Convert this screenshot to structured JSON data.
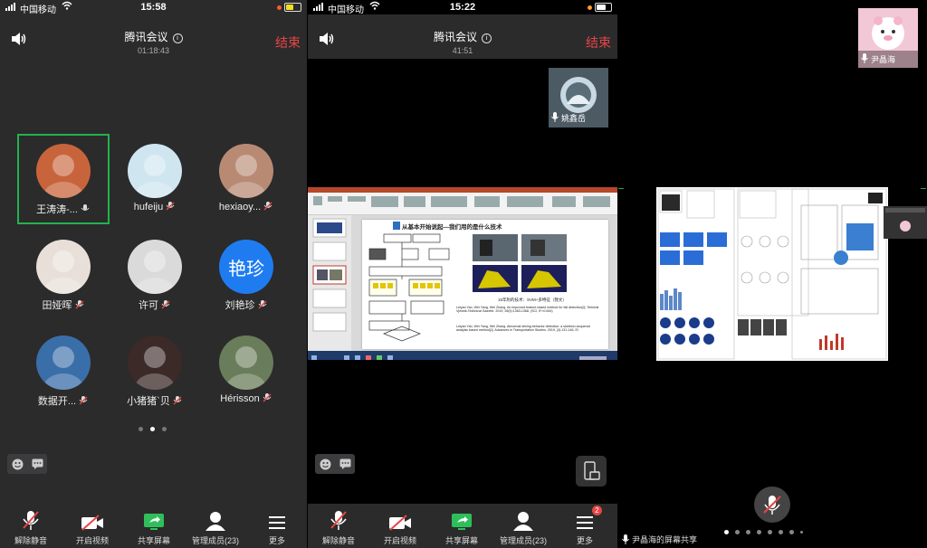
{
  "panel1": {
    "status": {
      "carrier": "中国移动",
      "time": "15:58"
    },
    "header": {
      "title": "腾讯会议",
      "duration": "01:18:43",
      "end_label": "结束"
    },
    "participants": [
      {
        "name": "王涛涛-...",
        "mic": "on",
        "selected": true,
        "avatar_color": "#c8643c"
      },
      {
        "name": "hufeiju",
        "mic": "muted",
        "avatar_color": "#cfe6f0"
      },
      {
        "name": "hexiaoy...",
        "mic": "muted",
        "avatar_color": "#b88a74"
      },
      {
        "name": "田娅晖",
        "mic": "muted",
        "avatar_color": "#e8e0d8"
      },
      {
        "name": "许可",
        "mic": "muted",
        "avatar_color": "#dadada"
      },
      {
        "name": "刘艳珍",
        "mic": "muted",
        "avatar_color": "#1f7cf0",
        "avatar_text": "艳珍"
      },
      {
        "name": "数据开...",
        "mic": "muted",
        "avatar_color": "#3a6ea8"
      },
      {
        "name": "小猪猪`贝",
        "mic": "muted",
        "avatar_color": "#3b2a28"
      },
      {
        "name": "Hérisson",
        "mic": "muted",
        "avatar_color": "#6a7d5a"
      }
    ],
    "page_dots": 3,
    "active_dot": 1
  },
  "panel2": {
    "status": {
      "carrier": "中国移动",
      "time": "15:22"
    },
    "header": {
      "title": "腾讯会议",
      "duration": "41:51",
      "end_label": "结束"
    },
    "pip_name": "姚鑫岳",
    "slide": {
      "heading": "从基本开始说起—我们用的是什么技术",
      "caption": "15年附的技术：SVM+多特征（我文）",
      "ref1": "Leiyan Yao, Wei Yang, Wei Zhang. An improved feature-based method for fall detection[J]. Tehnicki Vjesnik-Technical Gazette. 2019, 26(5):1363-1368. (SCI, IF=0.644)",
      "ref2": "Leiyan Yao, Wei Yang, Wei Zhang. Abnormal driving behavior detection: a skeleton sequence analysis based method[J]. Advances in Transportation Studies. 2019, (3):131-146. EI"
    }
  },
  "panel3": {
    "pip_name": "尹晶海",
    "footer_text": "尹晶海的屏幕共享",
    "page_dots": 8,
    "active_dot": 0
  },
  "toolbar": [
    {
      "label": "解除静音",
      "icon": "mic-muted-icon"
    },
    {
      "label": "开启视频",
      "icon": "camera-off-icon"
    },
    {
      "label": "共享屏幕",
      "icon": "screen-share-icon"
    },
    {
      "label": "管理成员(23)",
      "icon": "members-icon"
    },
    {
      "label": "更多",
      "icon": "more-menu-icon"
    }
  ],
  "panel2_more_badge": "2",
  "colors": {
    "accent_green": "#22b24c",
    "end_red": "#e64545",
    "avatar_blue": "#1f7cf0"
  }
}
